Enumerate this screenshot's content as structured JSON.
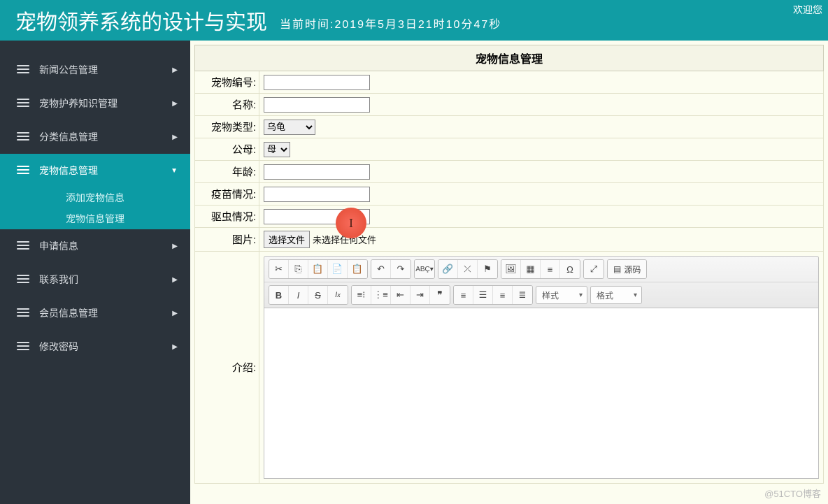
{
  "header": {
    "title": "宠物领养系统的设计与实现",
    "time_prefix": "当前时间:",
    "time_value": "2019年5月3日21时10分47秒",
    "welcome": "欢迎您"
  },
  "sidebar": {
    "items": [
      {
        "label": "新闻公告管理"
      },
      {
        "label": "宠物护养知识管理"
      },
      {
        "label": "分类信息管理"
      },
      {
        "label": "宠物信息管理",
        "active": true
      },
      {
        "label": "申请信息"
      },
      {
        "label": "联系我们"
      },
      {
        "label": "会员信息管理"
      },
      {
        "label": "修改密码"
      }
    ],
    "sub": [
      {
        "label": "添加宠物信息"
      },
      {
        "label": "宠物信息管理"
      }
    ]
  },
  "panel": {
    "title": "宠物信息管理"
  },
  "form": {
    "id_label": "宠物编号:",
    "name_label": "名称:",
    "type_label": "宠物类型:",
    "type_selected": "乌龟",
    "gender_label": "公母:",
    "gender_selected": "母",
    "age_label": "年龄:",
    "vaccine_label": "疫苗情况:",
    "deworm_label": "驱虫情况:",
    "image_label": "图片:",
    "file_button": "选择文件",
    "file_status": "未选择任何文件",
    "intro_label": "介绍:"
  },
  "editor": {
    "source_label": "源码",
    "style_label": "样式",
    "format_label": "格式"
  },
  "watermark": "@51CTO博客"
}
